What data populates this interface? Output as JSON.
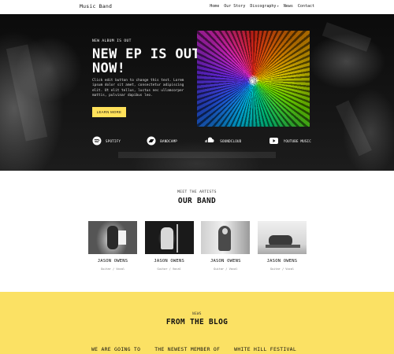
{
  "header": {
    "brand": "Music Band",
    "nav": [
      {
        "label": "Home"
      },
      {
        "label": "Our Story"
      },
      {
        "label": "Discography",
        "chevron": "▾"
      },
      {
        "label": "News"
      },
      {
        "label": "Contact"
      }
    ]
  },
  "hero": {
    "eyebrow": "NEW ALBUM IS OUT",
    "title": "NEW EP IS OUT NOW!",
    "body": "Click edit button to change this text. Lorem ipsum dolor sit amet, consectetur adipiscing elit. Ut elit tellus, luctus nec ullamcorper mattis, pulvinar dapibus leo.",
    "cta_label": "LEARN MORE",
    "streams": [
      {
        "label": "SPOTIFY",
        "icon": "spotify-icon"
      },
      {
        "label": "BANDCAMP",
        "icon": "bandcamp-icon"
      },
      {
        "label": "SOUNDCLOUD",
        "icon": "soundcloud-icon"
      },
      {
        "label": "YOUTUBE MUSIC",
        "icon": "youtube-icon"
      }
    ]
  },
  "band": {
    "eyebrow": "MEET THE ARTISTS",
    "title": "OUR BAND",
    "artists": [
      {
        "name": "JASON OWENS",
        "role": "Guitar / Vocal"
      },
      {
        "name": "JASON OWENS",
        "role": "Guitar / Vocal"
      },
      {
        "name": "JASON OWENS",
        "role": "Guitar / Vocal"
      },
      {
        "name": "JASON OWENS",
        "role": "Guitar / Vocal"
      }
    ]
  },
  "blog": {
    "eyebrow": "NEWS",
    "title": "FROM THE BLOG",
    "posts": [
      {
        "title": "WE ARE GOING TO"
      },
      {
        "title": "THE NEWEST MEMBER OF"
      },
      {
        "title": "WHITE HILL FESTIVAL"
      }
    ]
  },
  "colors": {
    "accent": "#ffe15a",
    "blog_background": "#fbe164",
    "hero_background": "#111111"
  }
}
